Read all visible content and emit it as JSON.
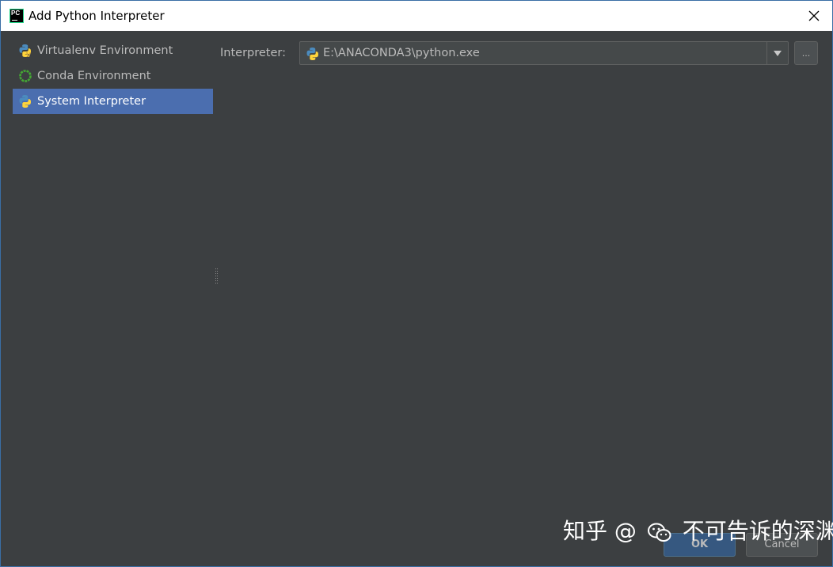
{
  "window": {
    "title": "Add Python Interpreter",
    "app_icon_text": "PC"
  },
  "sidebar": {
    "items": [
      {
        "label": "Virtualenv Environment",
        "icon": "virtualenv-python-icon",
        "selected": false
      },
      {
        "label": "Conda Environment",
        "icon": "conda-ring-icon",
        "selected": false
      },
      {
        "label": "System Interpreter",
        "icon": "python-icon",
        "selected": true
      }
    ]
  },
  "interpreter": {
    "label": "Interpreter:",
    "value": "E:\\ANACONDA3\\python.exe",
    "browse_label": "..."
  },
  "buttons": {
    "ok": "OK",
    "cancel": "Cancel"
  },
  "watermark": {
    "prefix": "知乎 @",
    "suffix": "不可告诉的深渊"
  },
  "colors": {
    "selection": "#4b6eaf",
    "panel_bg": "#3c3f41",
    "conda_green": "#44a833"
  }
}
